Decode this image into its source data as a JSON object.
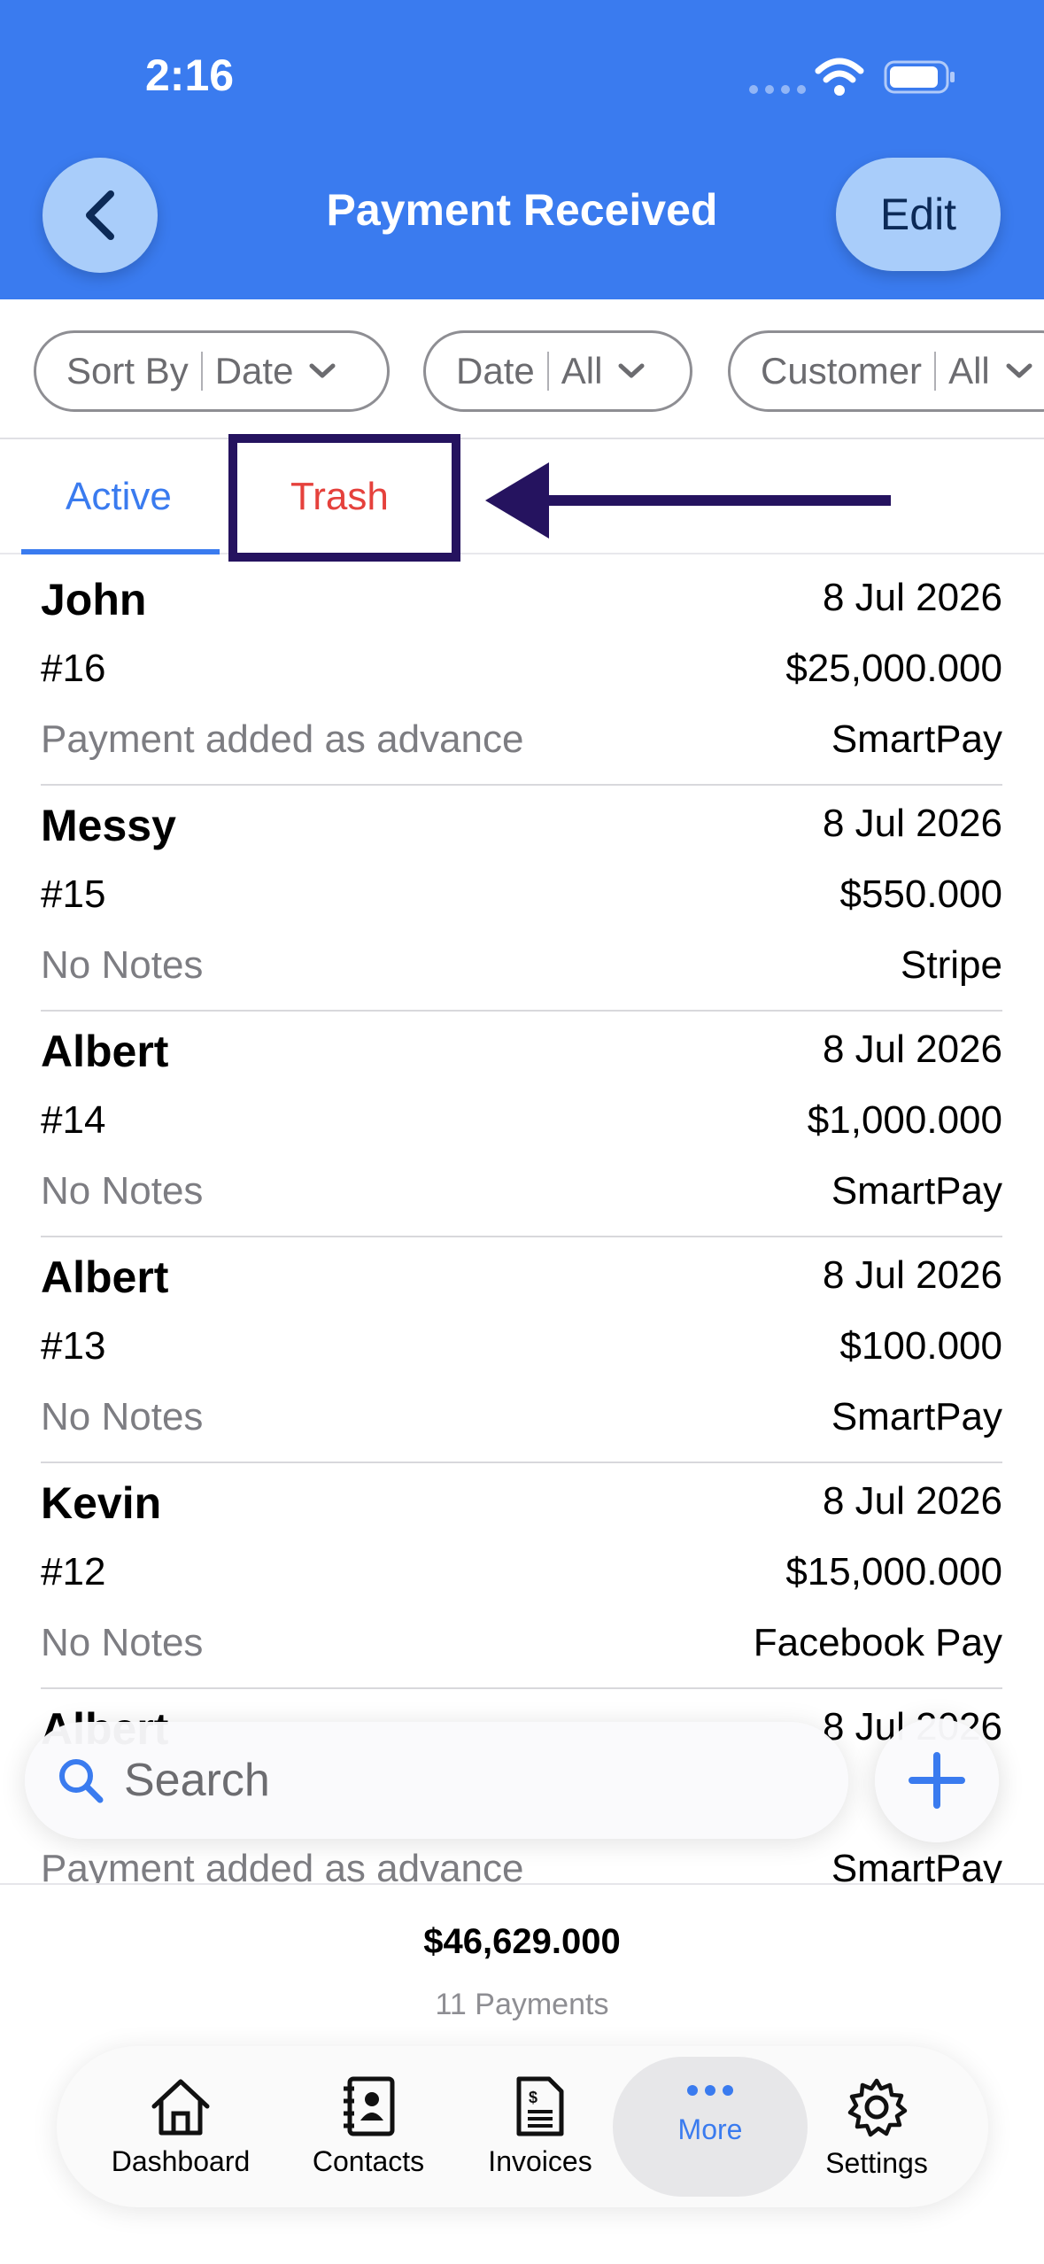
{
  "status_bar": {
    "time": "2:16"
  },
  "header": {
    "title": "Payment Received",
    "edit_label": "Edit"
  },
  "filters": [
    {
      "label": "Sort By",
      "value": "Date"
    },
    {
      "label": "Date",
      "value": "All"
    },
    {
      "label": "Customer",
      "value": "All"
    }
  ],
  "tabs": {
    "active_label": "Active",
    "trash_label": "Trash"
  },
  "payments": [
    {
      "name": "John",
      "date": "8 Jul 2026",
      "number": "#16",
      "amount": "$25,000.000",
      "note": "Payment added as advance",
      "method": "SmartPay"
    },
    {
      "name": "Messy",
      "date": "8 Jul 2026",
      "number": "#15",
      "amount": "$550.000",
      "note": "No Notes",
      "method": "Stripe"
    },
    {
      "name": "Albert",
      "date": "8 Jul 2026",
      "number": "#14",
      "amount": "$1,000.000",
      "note": "No Notes",
      "method": "SmartPay"
    },
    {
      "name": "Albert",
      "date": "8 Jul 2026",
      "number": "#13",
      "amount": "$100.000",
      "note": "No Notes",
      "method": "SmartPay"
    },
    {
      "name": "Kevin",
      "date": "8 Jul 2026",
      "number": "#12",
      "amount": "$15,000.000",
      "note": "No Notes",
      "method": "Facebook Pay"
    },
    {
      "name": "Albert",
      "date": "8 Jul 2026",
      "number": "",
      "amount": "",
      "note": "Payment added as advance",
      "method": "SmartPay"
    }
  ],
  "search": {
    "placeholder": "Search"
  },
  "summary": {
    "total": "$46,629.000",
    "count": "11 Payments"
  },
  "tabbar": {
    "dashboard": "Dashboard",
    "contacts": "Contacts",
    "invoices": "Invoices",
    "more": "More",
    "settings": "Settings"
  },
  "colors": {
    "accent": "#3a7bef",
    "trash": "#e5413c",
    "annotation": "#25135f"
  }
}
